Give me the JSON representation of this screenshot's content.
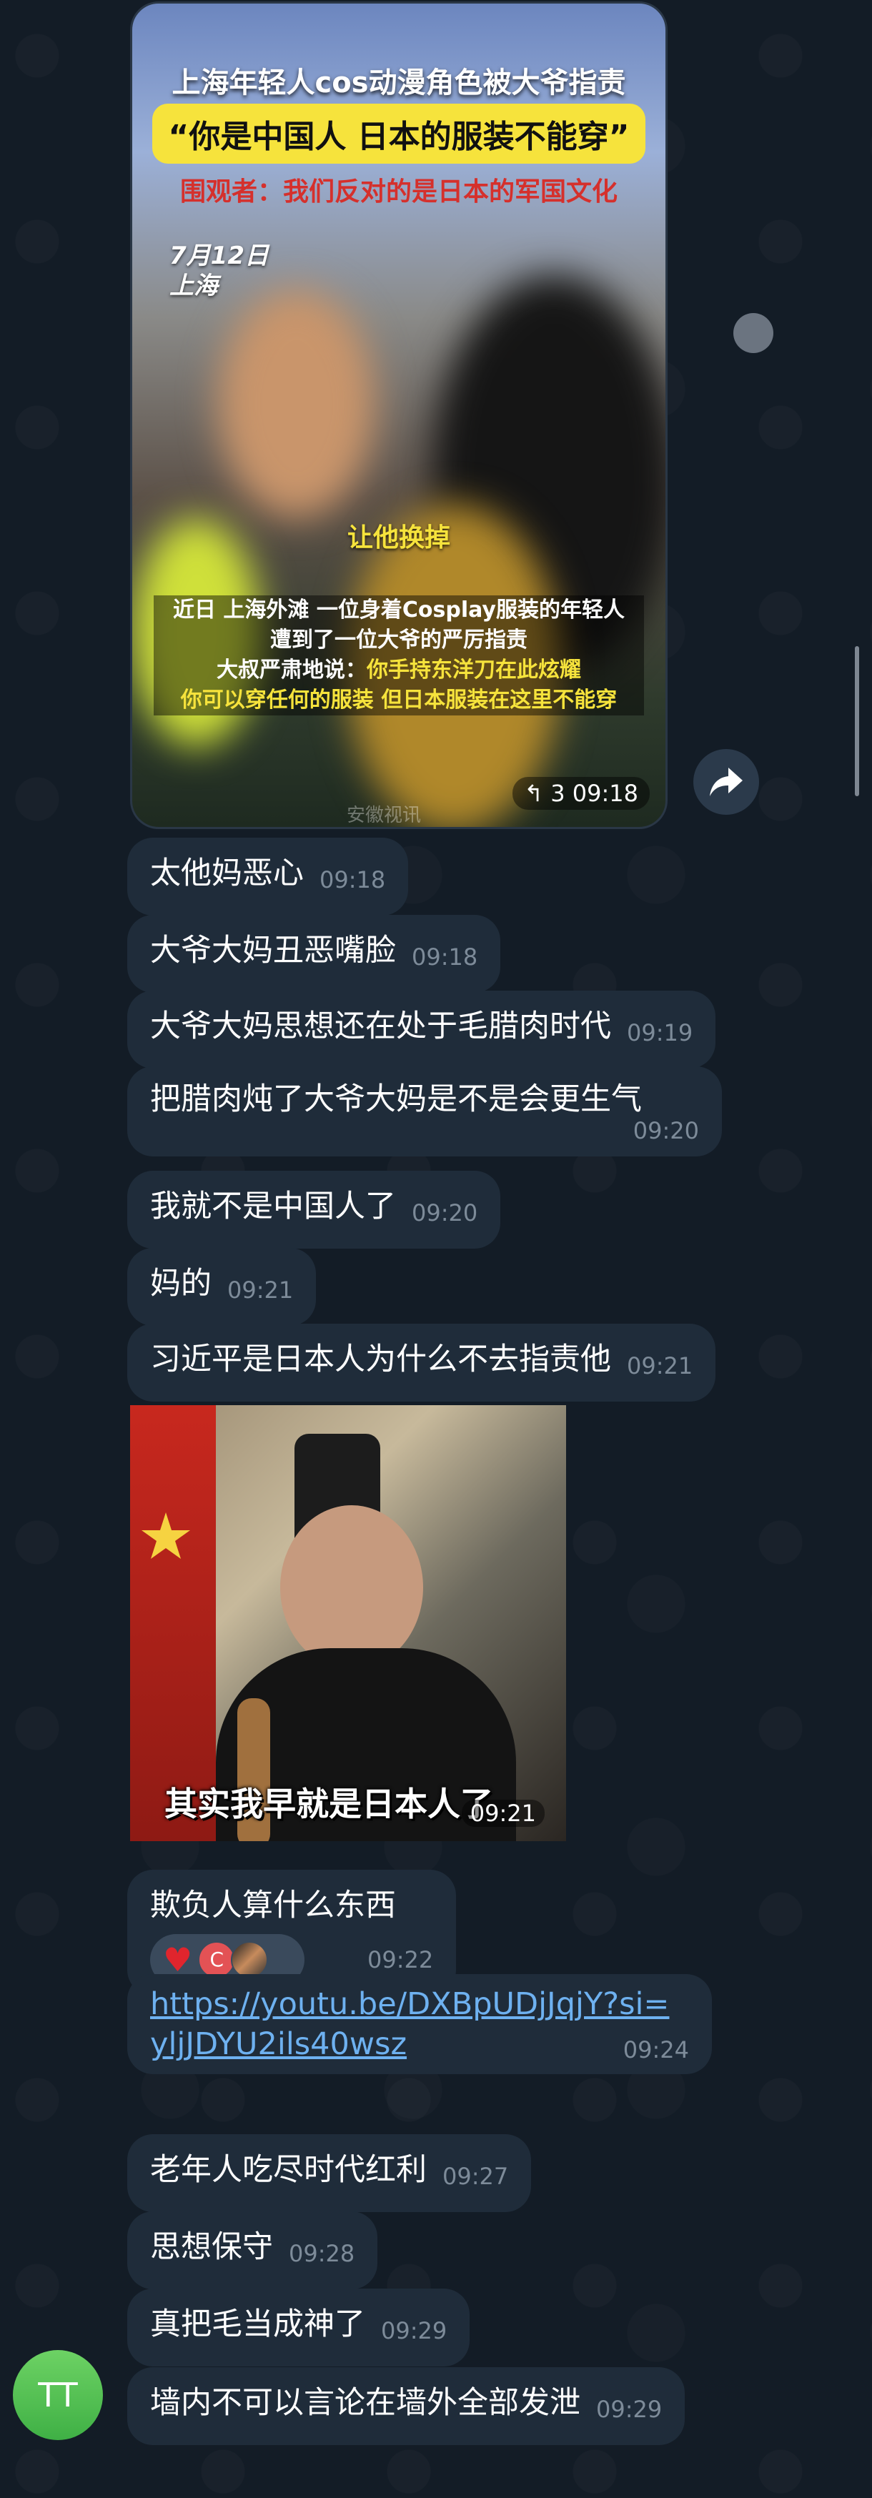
{
  "video": {
    "title": "上海年轻人cos动漫角色被大爷指责",
    "quote": "“你是中国人 日本的服装不能穿”",
    "subtitle": "围观者：我们反对的是日本的军国文化",
    "date_line1": "7月12日",
    "date_line2": "上海",
    "caption_top": "让他换掉",
    "caption_line1": "近日 上海外滩 一位身着Cosplay服装的年轻人",
    "caption_line2": "遭到了一位大爷的严厉指责",
    "caption_line3_prefix": "大叔严肃地说：",
    "caption_line3_highlight": "你手持东洋刀在此炫耀",
    "caption_line4": "你可以穿任何的服装 但日本服装在这里不能穿",
    "forward_count": "↰ 3",
    "time": "09:18",
    "watermark": "安徽视讯"
  },
  "messages": [
    {
      "text": "太他妈恶心",
      "time": "09:18"
    },
    {
      "text": "大爷大妈丑恶嘴脸",
      "time": "09:18"
    },
    {
      "text": "大爷大妈思想还在处于毛腊肉时代",
      "time": "09:19"
    },
    {
      "text": "把腊肉炖了大爷大妈是不是会更生气",
      "time": "09:20"
    },
    {
      "text": "我就不是中国人了",
      "time": "09:20"
    },
    {
      "text": "妈的",
      "time": "09:21"
    },
    {
      "text": "习近平是日本人为什么不去指责他",
      "time": "09:21"
    }
  ],
  "photo": {
    "caption": "其实我早就是日本人了",
    "time": "09:21"
  },
  "messages2": [
    {
      "text": "欺负人算什么东西",
      "time": "09:22",
      "reaction_avatar": "C"
    },
    {
      "link_line1": "https://youtu.be/DXBpUDjJqjY?si=",
      "link_line2": "yljJDYU2ils40wsz",
      "time": "09:24"
    },
    {
      "text": "老年人吃尽时代红利",
      "time": "09:27"
    },
    {
      "text": "思想保守",
      "time": "09:28"
    },
    {
      "text": "真把毛当成神了",
      "time": "09:29"
    },
    {
      "text": "墙内不可以言论在墙外全部发泄",
      "time": "09:29"
    }
  ],
  "sender": {
    "initials": "TT"
  },
  "colors": {
    "background": "#131c26",
    "bubble": "#1f2c3a",
    "link": "#6eb1f0",
    "avatar": "#4cbf4f"
  }
}
